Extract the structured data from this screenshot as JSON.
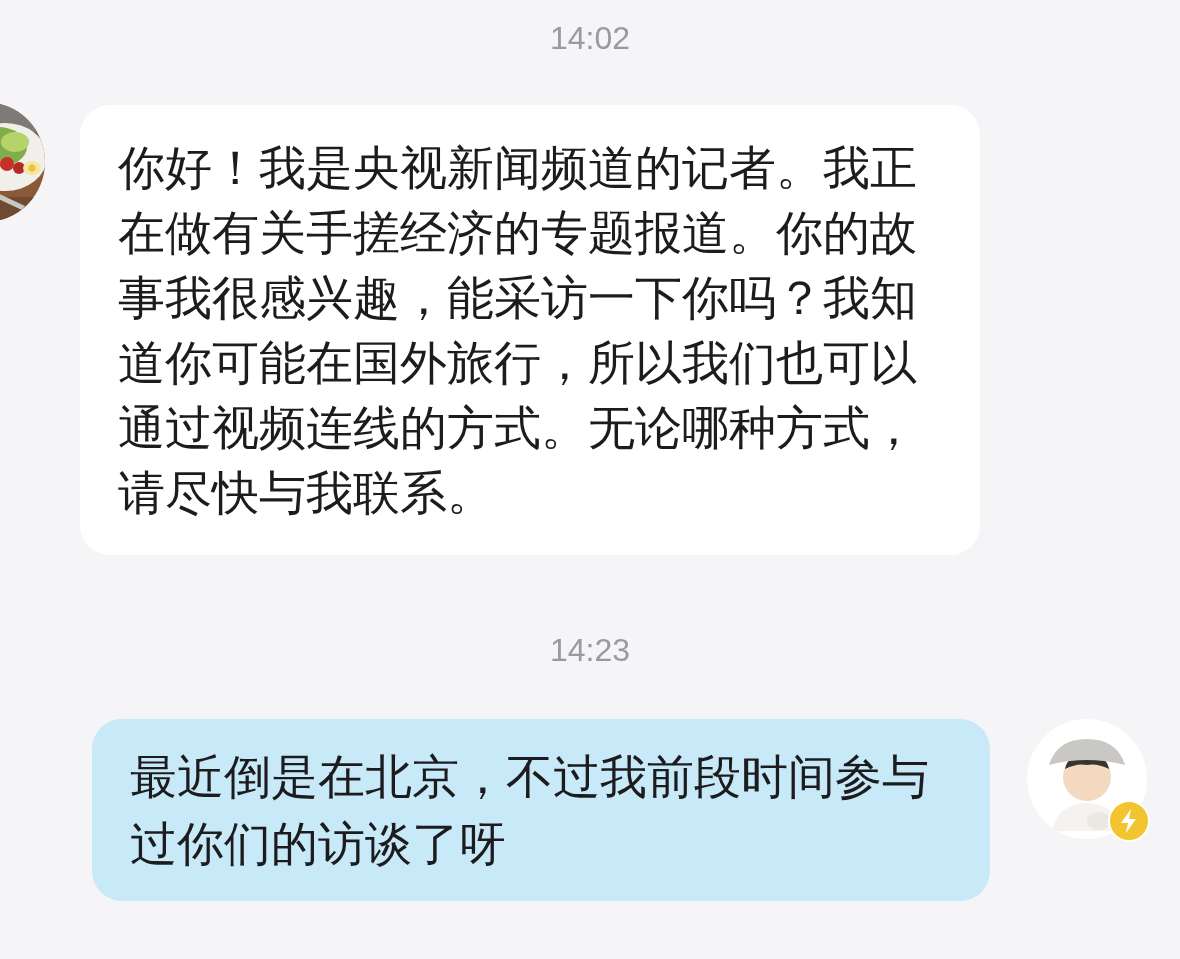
{
  "messages": [
    {
      "kind": "timestamp",
      "text": "14:02"
    },
    {
      "kind": "incoming",
      "text": "你好！我是央视新闻频道的记者。我正在做有关手搓经济的专题报道。你的故事我很感兴趣，能采访一下你吗？我知道你可能在国外旅行，所以我们也可以通过视频连线的方式。无论哪种方式，请尽快与我联系。"
    },
    {
      "kind": "timestamp",
      "text": "14:23"
    },
    {
      "kind": "outgoing",
      "avatar": {
        "kind": "figure",
        "badge": true
      },
      "text": "最近倒是在北京，不过我前段时间参与过你们的访谈了呀"
    }
  ]
}
